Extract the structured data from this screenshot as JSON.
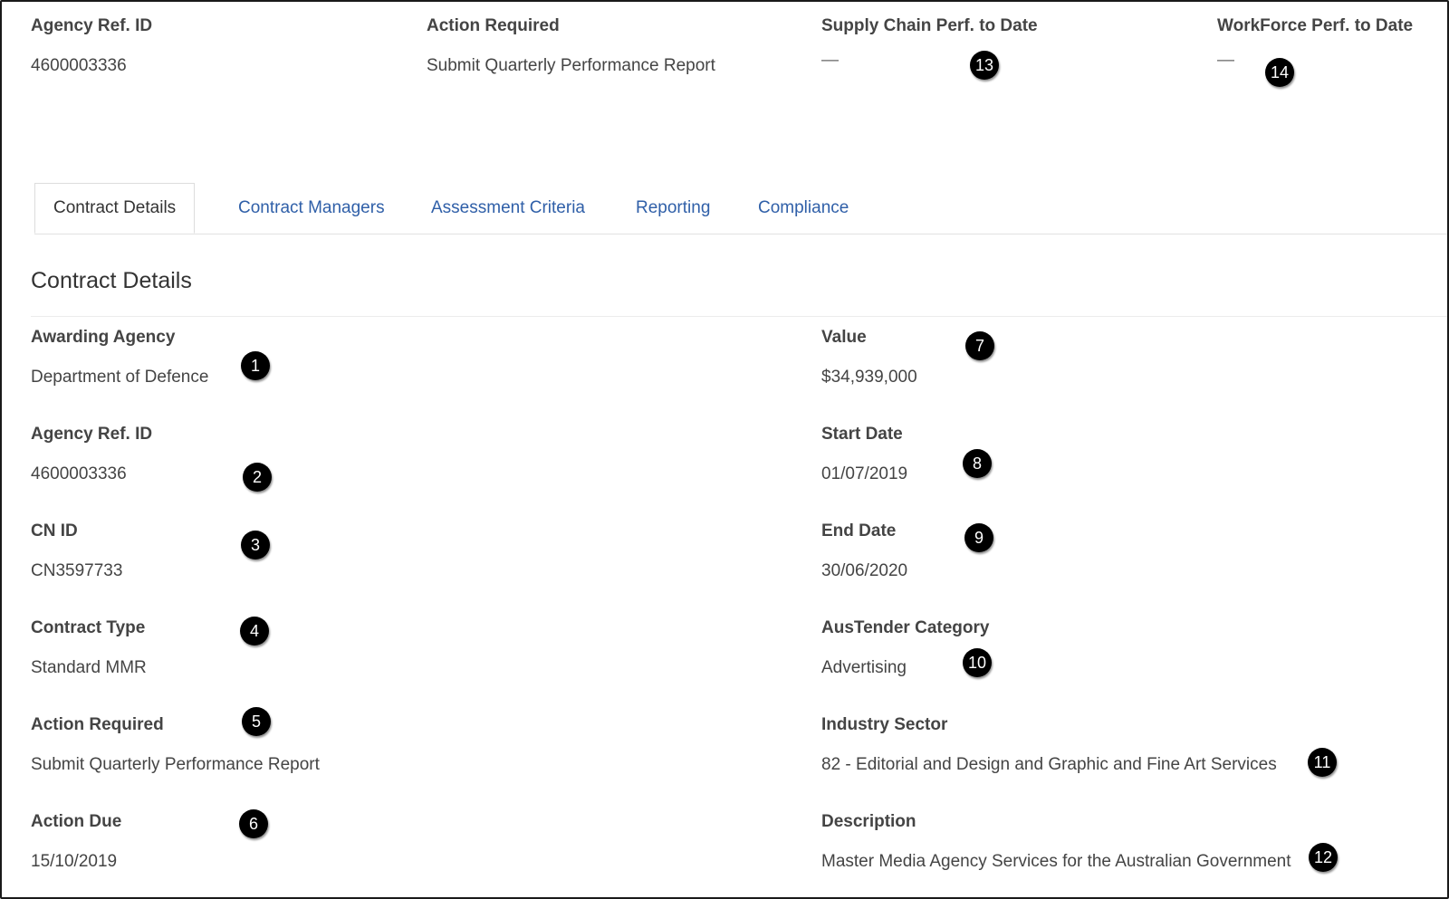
{
  "summary": {
    "agency_ref_label": "Agency Ref. ID",
    "agency_ref_value": "4600003336",
    "action_required_label": "Action Required",
    "action_required_value": "Submit Quarterly Performance Report",
    "supply_chain_label": "Supply Chain Perf. to Date",
    "supply_chain_value": "—",
    "workforce_label": "WorkForce Perf. to Date",
    "workforce_value": "—"
  },
  "tabs": [
    {
      "label": "Contract Details",
      "active": true
    },
    {
      "label": "Contract Managers"
    },
    {
      "label": "Assessment Criteria"
    },
    {
      "label": "Reporting"
    },
    {
      "label": "Compliance"
    }
  ],
  "section_title": "Contract Details",
  "left_fields": [
    {
      "label": "Awarding Agency",
      "value": "Department of Defence"
    },
    {
      "label": "Agency Ref. ID",
      "value": "4600003336"
    },
    {
      "label": "CN ID",
      "value": "CN3597733"
    },
    {
      "label": "Contract Type",
      "value": "Standard MMR"
    },
    {
      "label": "Action Required",
      "value": "Submit Quarterly Performance Report"
    },
    {
      "label": "Action Due",
      "value": "15/10/2019"
    }
  ],
  "right_fields": [
    {
      "label": "Value",
      "value": "$34,939,000"
    },
    {
      "label": "Start Date",
      "value": "01/07/2019"
    },
    {
      "label": "End Date",
      "value": "30/06/2020"
    },
    {
      "label": "AusTender Category",
      "value": "Advertising"
    },
    {
      "label": "Industry Sector",
      "value": "82 - Editorial and Design and Graphic and Fine Art Services"
    },
    {
      "label": "Description",
      "value": "Master Media Agency Services for the Australian Government"
    }
  ],
  "badges": [
    "1",
    "2",
    "3",
    "4",
    "5",
    "6",
    "7",
    "8",
    "9",
    "10",
    "11",
    "12",
    "13",
    "14"
  ],
  "colors": {
    "link": "#2f5fa8",
    "badge": "#000000",
    "text": "#444444"
  }
}
